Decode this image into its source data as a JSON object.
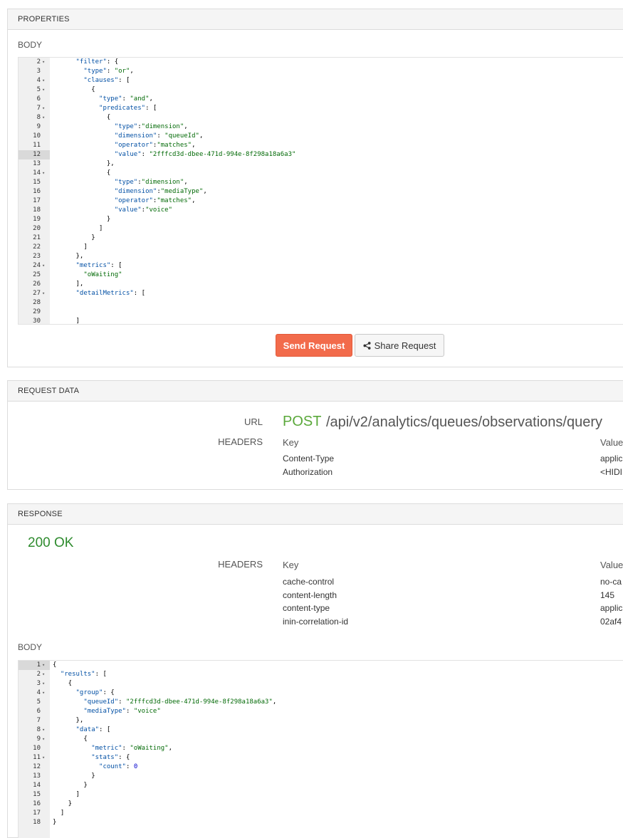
{
  "properties": {
    "header": "PROPERTIES",
    "body_label": "BODY",
    "editor_lines": [
      {
        "n": "2",
        "fold": true,
        "indent": 6,
        "segs": [
          [
            "k",
            "\"filter\""
          ],
          [
            "p",
            ": {"
          ]
        ]
      },
      {
        "n": "3",
        "fold": false,
        "indent": 8,
        "segs": [
          [
            "k",
            "\"type\""
          ],
          [
            "p",
            ": "
          ],
          [
            "s",
            "\"or\""
          ],
          [
            "p",
            ","
          ]
        ]
      },
      {
        "n": "4",
        "fold": true,
        "indent": 8,
        "segs": [
          [
            "k",
            "\"clauses\""
          ],
          [
            "p",
            ": ["
          ]
        ]
      },
      {
        "n": "5",
        "fold": true,
        "indent": 10,
        "segs": [
          [
            "p",
            "{"
          ]
        ]
      },
      {
        "n": "6",
        "fold": false,
        "indent": 12,
        "segs": [
          [
            "k",
            "\"type\""
          ],
          [
            "p",
            ": "
          ],
          [
            "s",
            "\"and\""
          ],
          [
            "p",
            ","
          ]
        ]
      },
      {
        "n": "7",
        "fold": true,
        "indent": 12,
        "segs": [
          [
            "k",
            "\"predicates\""
          ],
          [
            "p",
            ": ["
          ]
        ]
      },
      {
        "n": "8",
        "fold": true,
        "indent": 14,
        "segs": [
          [
            "p",
            "{"
          ]
        ]
      },
      {
        "n": "9",
        "fold": false,
        "indent": 16,
        "segs": [
          [
            "k",
            "\"type\""
          ],
          [
            "p",
            ":"
          ],
          [
            "s",
            "\"dimension\""
          ],
          [
            "p",
            ","
          ]
        ]
      },
      {
        "n": "10",
        "fold": false,
        "indent": 16,
        "segs": [
          [
            "k",
            "\"dimension\""
          ],
          [
            "p",
            ": "
          ],
          [
            "s",
            "\"queueId\""
          ],
          [
            "p",
            ","
          ]
        ]
      },
      {
        "n": "11",
        "fold": false,
        "indent": 16,
        "segs": [
          [
            "k",
            "\"operator\""
          ],
          [
            "p",
            ":"
          ],
          [
            "s",
            "\"matches\""
          ],
          [
            "p",
            ","
          ]
        ]
      },
      {
        "n": "12",
        "fold": false,
        "indent": 16,
        "hl": true,
        "segs": [
          [
            "k",
            "\"value\""
          ],
          [
            "p",
            ": "
          ],
          [
            "s",
            "\"2fffcd3d-dbee-471d-994e-8f298a18a6a3\""
          ]
        ]
      },
      {
        "n": "13",
        "fold": false,
        "indent": 14,
        "segs": [
          [
            "p",
            "},"
          ]
        ]
      },
      {
        "n": "14",
        "fold": true,
        "indent": 14,
        "segs": [
          [
            "p",
            "{"
          ]
        ]
      },
      {
        "n": "15",
        "fold": false,
        "indent": 16,
        "segs": [
          [
            "k",
            "\"type\""
          ],
          [
            "p",
            ":"
          ],
          [
            "s",
            "\"dimension\""
          ],
          [
            "p",
            ","
          ]
        ]
      },
      {
        "n": "16",
        "fold": false,
        "indent": 16,
        "segs": [
          [
            "k",
            "\"dimension\""
          ],
          [
            "p",
            ":"
          ],
          [
            "s",
            "\"mediaType\""
          ],
          [
            "p",
            ","
          ]
        ]
      },
      {
        "n": "17",
        "fold": false,
        "indent": 16,
        "segs": [
          [
            "k",
            "\"operator\""
          ],
          [
            "p",
            ":"
          ],
          [
            "s",
            "\"matches\""
          ],
          [
            "p",
            ","
          ]
        ]
      },
      {
        "n": "18",
        "fold": false,
        "indent": 16,
        "segs": [
          [
            "k",
            "\"value\""
          ],
          [
            "p",
            ":"
          ],
          [
            "s",
            "\"voice\""
          ]
        ]
      },
      {
        "n": "19",
        "fold": false,
        "indent": 14,
        "segs": [
          [
            "p",
            "}"
          ]
        ]
      },
      {
        "n": "20",
        "fold": false,
        "indent": 12,
        "segs": [
          [
            "p",
            "]"
          ]
        ]
      },
      {
        "n": "21",
        "fold": false,
        "indent": 10,
        "segs": [
          [
            "p",
            "}"
          ]
        ]
      },
      {
        "n": "22",
        "fold": false,
        "indent": 8,
        "segs": [
          [
            "p",
            "]"
          ]
        ]
      },
      {
        "n": "23",
        "fold": false,
        "indent": 6,
        "segs": [
          [
            "p",
            "},"
          ]
        ]
      },
      {
        "n": "24",
        "fold": true,
        "indent": 6,
        "segs": [
          [
            "k",
            "\"metrics\""
          ],
          [
            "p",
            ": ["
          ]
        ]
      },
      {
        "n": "25",
        "fold": false,
        "indent": 8,
        "segs": [
          [
            "s",
            "\"oWaiting\""
          ]
        ]
      },
      {
        "n": "26",
        "fold": false,
        "indent": 6,
        "segs": [
          [
            "p",
            "],"
          ]
        ]
      },
      {
        "n": "27",
        "fold": true,
        "indent": 6,
        "segs": [
          [
            "k",
            "\"detailMetrics\""
          ],
          [
            "p",
            ": ["
          ]
        ]
      },
      {
        "n": "28",
        "fold": false,
        "indent": 0,
        "segs": []
      },
      {
        "n": "29",
        "fold": false,
        "indent": 0,
        "segs": []
      },
      {
        "n": "30",
        "fold": false,
        "indent": 6,
        "segs": [
          [
            "p",
            "]"
          ]
        ]
      }
    ],
    "send_label": "Send Request",
    "share_label": "Share Request"
  },
  "request_data": {
    "header": "REQUEST DATA",
    "url_label": "URL",
    "method": "POST",
    "path": "/api/v2/analytics/queues/observations/query",
    "headers_label": "HEADERS",
    "key_col": "Key",
    "value_col": "Value",
    "rows": [
      {
        "key": "Content-Type",
        "value": "applic"
      },
      {
        "key": "Authorization",
        "value": "<HIDI"
      }
    ]
  },
  "response": {
    "header": "RESPONSE",
    "status": "200 OK",
    "headers_label": "HEADERS",
    "key_col": "Key",
    "value_col": "Value",
    "rows": [
      {
        "key": "cache-control",
        "value": "no-ca"
      },
      {
        "key": "content-length",
        "value": "145"
      },
      {
        "key": "content-type",
        "value": "applic"
      },
      {
        "key": "inin-correlation-id",
        "value": "02af4"
      }
    ],
    "body_label": "BODY",
    "editor_lines": [
      {
        "n": "1",
        "fold": true,
        "indent": 0,
        "hl": true,
        "segs": [
          [
            "p",
            "{"
          ]
        ]
      },
      {
        "n": "2",
        "fold": true,
        "indent": 2,
        "segs": [
          [
            "k",
            "\"results\""
          ],
          [
            "p",
            ": ["
          ]
        ]
      },
      {
        "n": "3",
        "fold": true,
        "indent": 4,
        "segs": [
          [
            "p",
            "{"
          ]
        ]
      },
      {
        "n": "4",
        "fold": true,
        "indent": 6,
        "segs": [
          [
            "k",
            "\"group\""
          ],
          [
            "p",
            ": {"
          ]
        ]
      },
      {
        "n": "5",
        "fold": false,
        "indent": 8,
        "segs": [
          [
            "k",
            "\"queueId\""
          ],
          [
            "p",
            ": "
          ],
          [
            "s",
            "\"2fffcd3d-dbee-471d-994e-8f298a18a6a3\""
          ],
          [
            "p",
            ","
          ]
        ]
      },
      {
        "n": "6",
        "fold": false,
        "indent": 8,
        "segs": [
          [
            "k",
            "\"mediaType\""
          ],
          [
            "p",
            ": "
          ],
          [
            "s",
            "\"voice\""
          ]
        ]
      },
      {
        "n": "7",
        "fold": false,
        "indent": 6,
        "segs": [
          [
            "p",
            "},"
          ]
        ]
      },
      {
        "n": "8",
        "fold": true,
        "indent": 6,
        "segs": [
          [
            "k",
            "\"data\""
          ],
          [
            "p",
            ": ["
          ]
        ]
      },
      {
        "n": "9",
        "fold": true,
        "indent": 8,
        "segs": [
          [
            "p",
            "{"
          ]
        ]
      },
      {
        "n": "10",
        "fold": false,
        "indent": 10,
        "segs": [
          [
            "k",
            "\"metric\""
          ],
          [
            "p",
            ": "
          ],
          [
            "s",
            "\"oWaiting\""
          ],
          [
            "p",
            ","
          ]
        ]
      },
      {
        "n": "11",
        "fold": true,
        "indent": 10,
        "segs": [
          [
            "k",
            "\"stats\""
          ],
          [
            "p",
            ": {"
          ]
        ]
      },
      {
        "n": "12",
        "fold": false,
        "indent": 12,
        "segs": [
          [
            "k",
            "\"count\""
          ],
          [
            "p",
            ": "
          ],
          [
            "n",
            "0"
          ]
        ]
      },
      {
        "n": "13",
        "fold": false,
        "indent": 10,
        "segs": [
          [
            "p",
            "}"
          ]
        ]
      },
      {
        "n": "14",
        "fold": false,
        "indent": 8,
        "segs": [
          [
            "p",
            "}"
          ]
        ]
      },
      {
        "n": "15",
        "fold": false,
        "indent": 6,
        "segs": [
          [
            "p",
            "]"
          ]
        ]
      },
      {
        "n": "16",
        "fold": false,
        "indent": 4,
        "segs": [
          [
            "p",
            "}"
          ]
        ]
      },
      {
        "n": "17",
        "fold": false,
        "indent": 2,
        "segs": [
          [
            "p",
            "]"
          ]
        ]
      },
      {
        "n": "18",
        "fold": false,
        "indent": 0,
        "segs": [
          [
            "p",
            "}"
          ]
        ]
      }
    ]
  },
  "colors": {
    "send_button": "#f26b4b",
    "method": "#5aa83a",
    "status_ok": "#2e8b2e",
    "json_key": "#0451a5",
    "json_string": "#036a07",
    "json_number": "#0000cd"
  },
  "icons": {
    "share": "share-icon",
    "fold": "fold-arrow-icon"
  }
}
